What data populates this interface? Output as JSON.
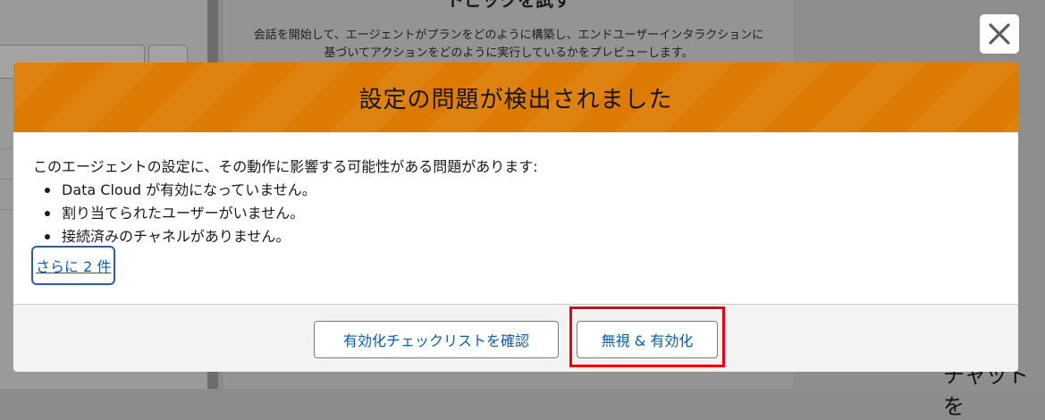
{
  "background": {
    "center_title": "トピックを試す",
    "center_description": "会話を開始して、エージェントがプランをどのように構築し、エンドユーザーインタラクションに基づいてアクションをどのように実行しているかをプレビューします。",
    "right_text": "チャットを"
  },
  "close": {
    "icon": "close-icon"
  },
  "modal": {
    "title": "設定の問題が検出されました",
    "header_color": "#dd7a01",
    "intro": "このエージェントの設定に、その動作に影響する可能性がある問題があります:",
    "issues": [
      "Data Cloud が有効になっていません。",
      "割り当てられたユーザーがいません。",
      "接続済みのチャネルがありません。"
    ],
    "more_link": "さらに 2 件",
    "buttons": {
      "checklist": "有効化チェックリストを確認",
      "ignore_enable": "無視 & 有効化"
    },
    "highlight_color": "#e8000f"
  }
}
